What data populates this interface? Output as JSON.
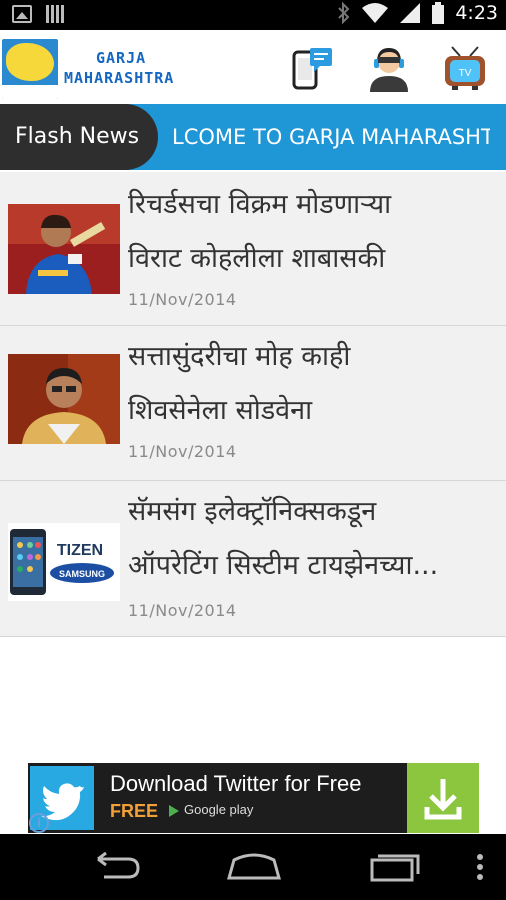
{
  "status_bar": {
    "time": "4:23",
    "icons": [
      "image-icon",
      "barcode-icon",
      "bluetooth-icon",
      "wifi-icon",
      "signal-icon",
      "battery-icon"
    ]
  },
  "header": {
    "brand_line1": "GARJA",
    "brand_line2": "MAHARASHTRA",
    "icons": [
      "mobile-message-icon",
      "support-agent-icon",
      "tv-icon"
    ]
  },
  "flash": {
    "label": "Flash News",
    "ticker": "LCOME TO GARJA MAHARASHTRA"
  },
  "news": [
    {
      "title_line1": "रिचर्डसचा विक्रम मोडणाऱ्या",
      "title_line2": "विराट कोहलीला शाबासकी",
      "date": "11/Nov/2014",
      "thumb": "cricketer-photo"
    },
    {
      "title_line1": "सत्तासुंदरीचा मोह काही",
      "title_line2": "शिवसेनेला सोडवेना",
      "date": "11/Nov/2014",
      "thumb": "politician-photo"
    },
    {
      "title_line1": "सॅमसंग इलेक्ट्रॉनिक्सकडून",
      "title_line2": "ऑपरेटिंग सिस्टीम टायझेनच्या...",
      "date": "11/Nov/2014",
      "thumb": "tizen-samsung-logo",
      "thumb_text1": "TIZEN",
      "thumb_text2": "SAMSUNG"
    }
  ],
  "ad": {
    "title": "Download Twitter for Free",
    "free": "FREE",
    "store": "Google play",
    "info": "i"
  },
  "colors": {
    "flash_bar": "#1f96d6",
    "flash_label": "#2e2e2e",
    "brand": "#1467c2",
    "list_bg": "#f1f1f1",
    "ad_free": "#f1a037",
    "ad_download": "#8cc63f"
  }
}
